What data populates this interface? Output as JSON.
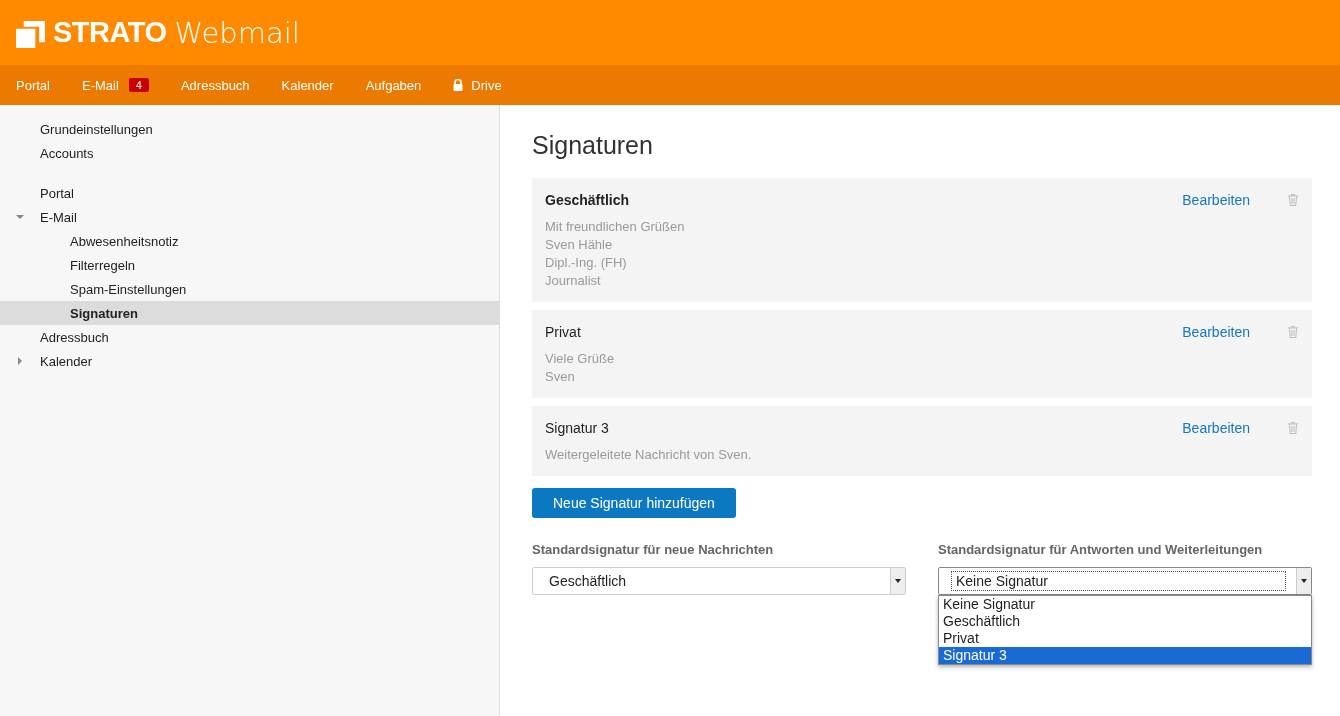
{
  "header": {
    "brand": "STRATO",
    "product": "Webmail"
  },
  "nav": [
    {
      "label": "Portal",
      "locked": false
    },
    {
      "label": "E-Mail",
      "badge": "4",
      "locked": false
    },
    {
      "label": "Adressbuch",
      "locked": false
    },
    {
      "label": "Kalender",
      "locked": false
    },
    {
      "label": "Aufgaben",
      "locked": false
    },
    {
      "label": "Drive",
      "locked": true
    }
  ],
  "sidebar": {
    "groups": [
      [
        {
          "label": "Grundeinstellungen",
          "selected": false
        },
        {
          "label": "Accounts",
          "selected": false
        }
      ],
      [
        {
          "label": "Portal",
          "selected": false
        },
        {
          "label": "E-Mail",
          "selected": false,
          "expanded": true,
          "children": [
            {
              "label": "Abwesenheitsnotiz",
              "selected": false
            },
            {
              "label": "Filterregeln",
              "selected": false
            },
            {
              "label": "Spam-Einstellungen",
              "selected": false
            },
            {
              "label": "Signaturen",
              "selected": true
            }
          ]
        },
        {
          "label": "Adressbuch",
          "selected": false
        },
        {
          "label": "Kalender",
          "selected": false,
          "expanded": false
        }
      ]
    ]
  },
  "page": {
    "title": "Signaturen",
    "signatures": [
      {
        "name": "Geschäftlich",
        "default": true,
        "lines": [
          "Mit freundlichen Grüßen",
          "Sven Hähle",
          "Dipl.-Ing. (FH)",
          "Journalist"
        ],
        "edit": "Bearbeiten"
      },
      {
        "name": "Privat",
        "default": false,
        "lines": [
          "Viele Grüße",
          "Sven"
        ],
        "edit": "Bearbeiten"
      },
      {
        "name": "Signatur 3",
        "default": false,
        "lines": [
          "Weitergeleitete Nachricht von Sven."
        ],
        "edit": "Bearbeiten"
      }
    ],
    "add_button": "Neue Signatur hinzufügen",
    "selects": [
      {
        "label": "Standardsignatur für neue Nachrichten",
        "value": "Geschäftlich",
        "open": false
      },
      {
        "label": "Standardsignatur für Antworten und Weiterleitungen",
        "value": "Keine Signatur",
        "open": true,
        "options": [
          {
            "label": "Keine Signatur",
            "highlighted": false
          },
          {
            "label": "Geschäftlich",
            "highlighted": false
          },
          {
            "label": "Privat",
            "highlighted": false
          },
          {
            "label": "Signatur 3",
            "highlighted": true
          }
        ]
      }
    ]
  }
}
